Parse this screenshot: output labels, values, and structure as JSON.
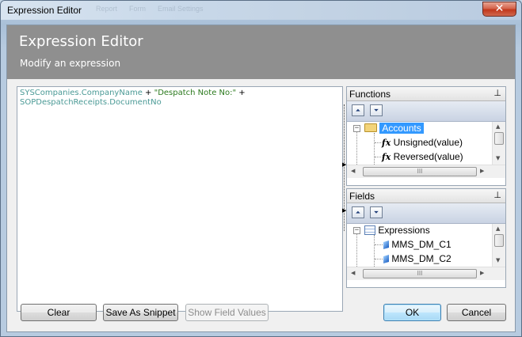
{
  "window": {
    "title": "Expression Editor",
    "close_glyph": "✕",
    "background_titles": [
      "Report",
      "Form",
      "Email Settings"
    ]
  },
  "banner": {
    "title": "Expression Editor",
    "subtitle": "Modify an expression"
  },
  "expression": {
    "line1_field": "SYSCompanies.CompanyName",
    "line1_op1": " + ",
    "line1_string": "\"Despatch Note No:\"",
    "line1_op2": " +",
    "line2_field": "SOPDespatchReceipts.DocumentNo"
  },
  "functions_panel": {
    "header": "Functions",
    "pin_glyph": "📌",
    "collapse_all_glyph": "⏶",
    "expand_all_glyph": "⏷",
    "tree": {
      "root": {
        "label": "Accounts",
        "icon": "folder-icon",
        "expander": "−",
        "selected": true
      },
      "children": [
        {
          "label": "Unsigned(value)",
          "icon": "function-icon",
          "icon_text": "fx"
        },
        {
          "label": "Reversed(value)",
          "icon": "function-icon",
          "icon_text": "fx"
        }
      ]
    }
  },
  "fields_panel": {
    "header": "Fields",
    "pin_glyph": "📌",
    "collapse_all_glyph": "⏶",
    "expand_all_glyph": "⏷",
    "tree": {
      "root": {
        "label": "Expressions",
        "icon": "table-icon",
        "expander": "−"
      },
      "children": [
        {
          "label": "MMS_DM_C1",
          "icon": "field-icon"
        },
        {
          "label": "MMS_DM_C2",
          "icon": "field-icon"
        }
      ]
    }
  },
  "buttons": {
    "clear": "Clear",
    "save_snippet": "Save As Snippet",
    "show_field_values": "Show Field Values",
    "ok": "OK",
    "cancel": "Cancel"
  },
  "colors": {
    "banner_bg": "#8f8f8f",
    "field_token": "#4b9a96",
    "string_token": "#2c7a1e",
    "selection": "#3399ff"
  }
}
